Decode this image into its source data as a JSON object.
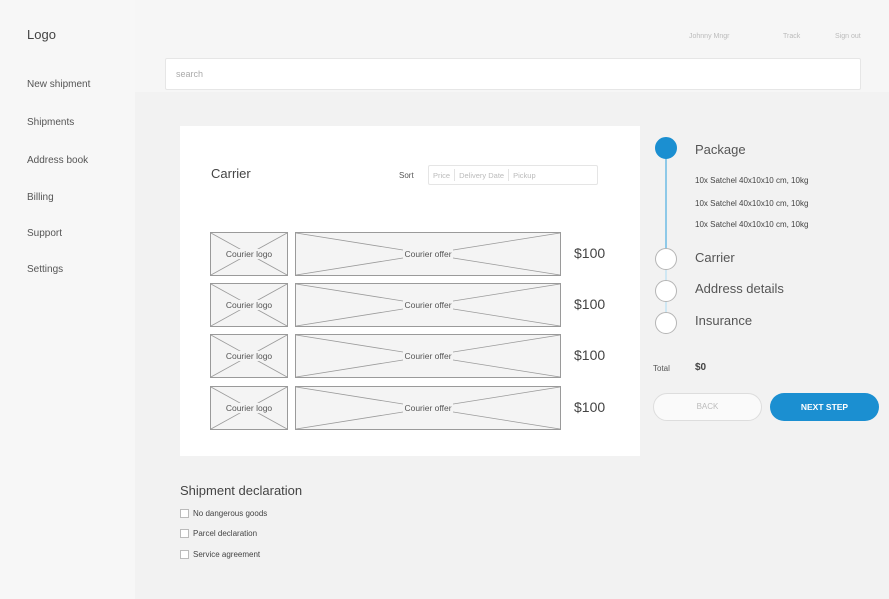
{
  "app": {
    "logo": "Logo"
  },
  "sidebar": {
    "items": [
      {
        "label": "New shipment"
      },
      {
        "label": "Shipments"
      },
      {
        "label": "Address book"
      },
      {
        "label": "Billing"
      },
      {
        "label": "Support"
      },
      {
        "label": "Settings"
      }
    ]
  },
  "header": {
    "links": [
      {
        "label": "Johnny Mngr"
      },
      {
        "label": "Track"
      },
      {
        "label": "Sign out"
      }
    ],
    "search": {
      "placeholder": "search"
    }
  },
  "carrier_panel": {
    "title": "Carrier",
    "sort_label": "Sort",
    "sort_options": [
      "Price",
      "Delivery Date",
      "Pickup"
    ],
    "offers": [
      {
        "logo_label": "Courier logo",
        "offer_label": "Courier offer",
        "price": "$100"
      },
      {
        "logo_label": "Courier logo",
        "offer_label": "Courier offer",
        "price": "$100"
      },
      {
        "logo_label": "Courier logo",
        "offer_label": "Courier offer",
        "price": "$100"
      },
      {
        "logo_label": "Courier logo",
        "offer_label": "Courier offer",
        "price": "$100"
      }
    ]
  },
  "steps": {
    "items": [
      {
        "label": "Package",
        "active": true
      },
      {
        "label": "Carrier",
        "active": false
      },
      {
        "label": "Address details",
        "active": false
      },
      {
        "label": "Insurance",
        "active": false
      }
    ],
    "package_lines": [
      "10x Satchel 40x10x10 cm, 10kg",
      "10x Satchel 40x10x10 cm, 10kg",
      "10x Satchel 40x10x10 cm, 10kg"
    ]
  },
  "summary": {
    "total_label": "Total",
    "total_value": "$0",
    "back_label": "BACK",
    "next_label": "NEXT STEP"
  },
  "declaration": {
    "title": "Shipment declaration",
    "items": [
      {
        "label": "No dangerous goods",
        "checked": false
      },
      {
        "label": "Parcel declaration",
        "checked": false
      },
      {
        "label": "Service agreement",
        "checked": false
      }
    ]
  },
  "colors": {
    "accent": "#1b8fd1",
    "background": "#f2f2f2",
    "card": "#ffffff"
  }
}
